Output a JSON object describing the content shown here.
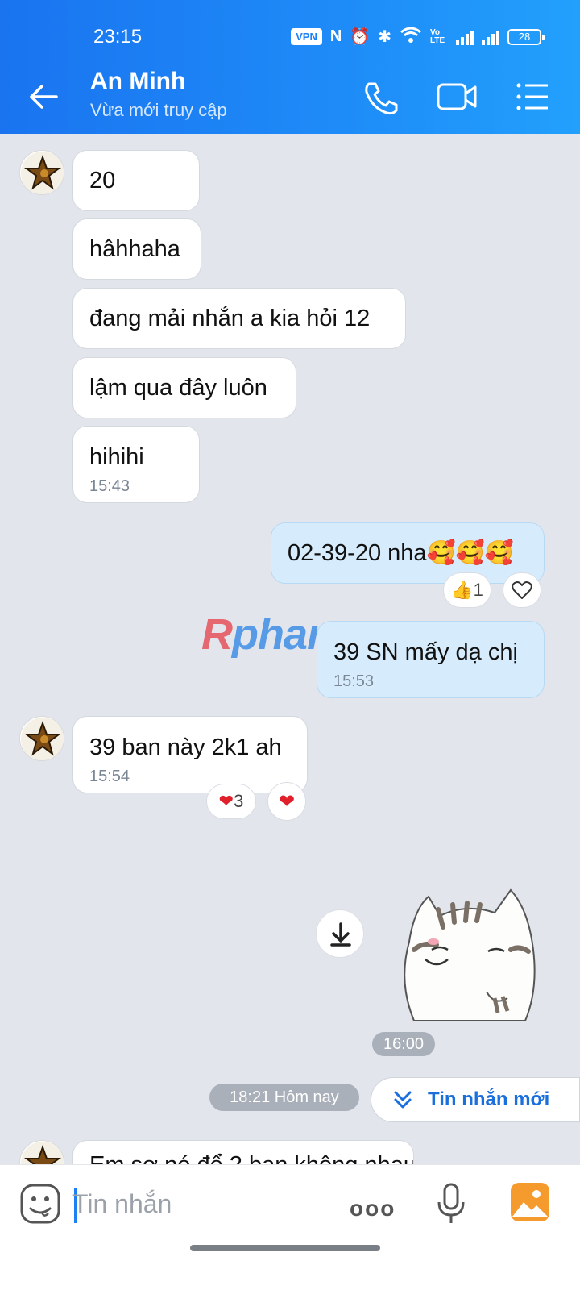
{
  "status_bar": {
    "time": "23:15",
    "vpn": "VPN",
    "volte": "Vo LTE",
    "battery": "28"
  },
  "header": {
    "contact_name": "An Minh",
    "contact_status": "Vừa mới truy cập"
  },
  "messages": {
    "m1": "20",
    "m2": "hâhhaha",
    "m3": "đang mải nhắn a kia hỏi 12",
    "m4": "lậm qua đây luôn",
    "m5": "hihihi",
    "m5_time": "15:43",
    "m6": "02-39-20 nha🥰🥰🥰",
    "m6_reaction_count": "1",
    "m7": "39 SN mấy dạ chị",
    "m7_time": "15:53",
    "m8": "39 ban này 2k1 ah",
    "m8_time": "15:54",
    "m8_reaction_count": "3",
    "sticker_time": "16:00",
    "m9_partial": "Em sợ nó để 2 bạn không nhau"
  },
  "date_divider": "18:21 Hôm nay",
  "new_messages_button": "Tin nhắn mới",
  "watermark": {
    "part1": "R",
    "part2": "phang"
  },
  "composer": {
    "placeholder": "Tin nhắn",
    "more_dots": "ooo"
  }
}
